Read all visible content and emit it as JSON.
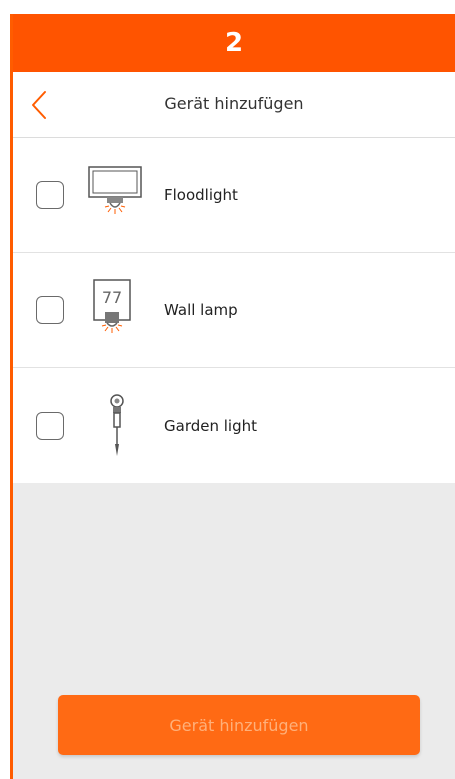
{
  "step": {
    "number": "2"
  },
  "header": {
    "back_icon": "chevron-left-icon",
    "title": "Gerät hinzufügen"
  },
  "devices": [
    {
      "label": "Floodlight",
      "icon": "floodlight-icon",
      "checked": false
    },
    {
      "label": "Wall lamp",
      "icon": "wall-lamp-icon",
      "badge": "77",
      "checked": false
    },
    {
      "label": "Garden light",
      "icon": "garden-light-icon",
      "checked": false
    }
  ],
  "footer": {
    "add_button_label": "Gerät hinzufügen",
    "add_button_enabled": false
  },
  "colors": {
    "accent": "#ff5400",
    "button": "#ff6a14",
    "button_text_disabled": "#ffb07a",
    "background": "#ebebeb"
  }
}
